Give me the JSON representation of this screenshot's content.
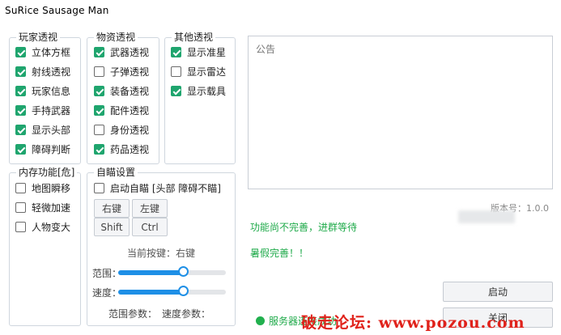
{
  "window": {
    "title": "SuRice Sausage Man"
  },
  "player_group": {
    "title": "玩家透视",
    "items": [
      {
        "label": "立体方框",
        "checked": true
      },
      {
        "label": "射线透视",
        "checked": true
      },
      {
        "label": "玩家信息",
        "checked": true
      },
      {
        "label": "手持武器",
        "checked": true
      },
      {
        "label": "显示头部",
        "checked": true
      },
      {
        "label": "障碍判断",
        "checked": true
      }
    ]
  },
  "item_group": {
    "title": "物资透视",
    "items": [
      {
        "label": "武器透视",
        "checked": true
      },
      {
        "label": "子弹透视",
        "checked": false
      },
      {
        "label": "装备透视",
        "checked": true
      },
      {
        "label": "配件透视",
        "checked": true
      },
      {
        "label": "身份透视",
        "checked": false
      },
      {
        "label": "药品透视",
        "checked": true
      }
    ]
  },
  "other_group": {
    "title": "其他透视",
    "items": [
      {
        "label": "显示准星",
        "checked": true
      },
      {
        "label": "显示雷达",
        "checked": false
      },
      {
        "label": "显示载具",
        "checked": true
      }
    ]
  },
  "memory_group": {
    "title": "内存功能[危]",
    "items": [
      {
        "label": "地图瞬移",
        "checked": false
      },
      {
        "label": "轻微加速",
        "checked": false
      },
      {
        "label": "人物变大",
        "checked": false
      }
    ]
  },
  "aim_group": {
    "title": "自瞄设置",
    "enable": {
      "label": "启动自瞄 [头部 障碍不瞄]",
      "checked": false
    },
    "keys": [
      "右键",
      "左键",
      "Shift",
      "Ctrl"
    ],
    "current_key": "当前按键：右键",
    "range_label": "范围：",
    "range_value": 0.6,
    "speed_label": "速度：",
    "speed_value": 0.6,
    "range_param": "范围参数：",
    "speed_param": "速度参数："
  },
  "notice": {
    "placeholder": "公告"
  },
  "version": "版本号：1.0.0",
  "status_incomplete": "功能尚不完善，进群等待",
  "status_summer": "暑假完善！！",
  "buttons": {
    "start": "启动",
    "close": "关闭"
  },
  "server_status": "服务器连接成功",
  "watermark": "破走论坛: www.pozou.com",
  "colors": {
    "accent": "#1fa56e",
    "slider": "#1e8fe6",
    "status_green": "#1faa4a",
    "watermark": "#e0221b"
  }
}
